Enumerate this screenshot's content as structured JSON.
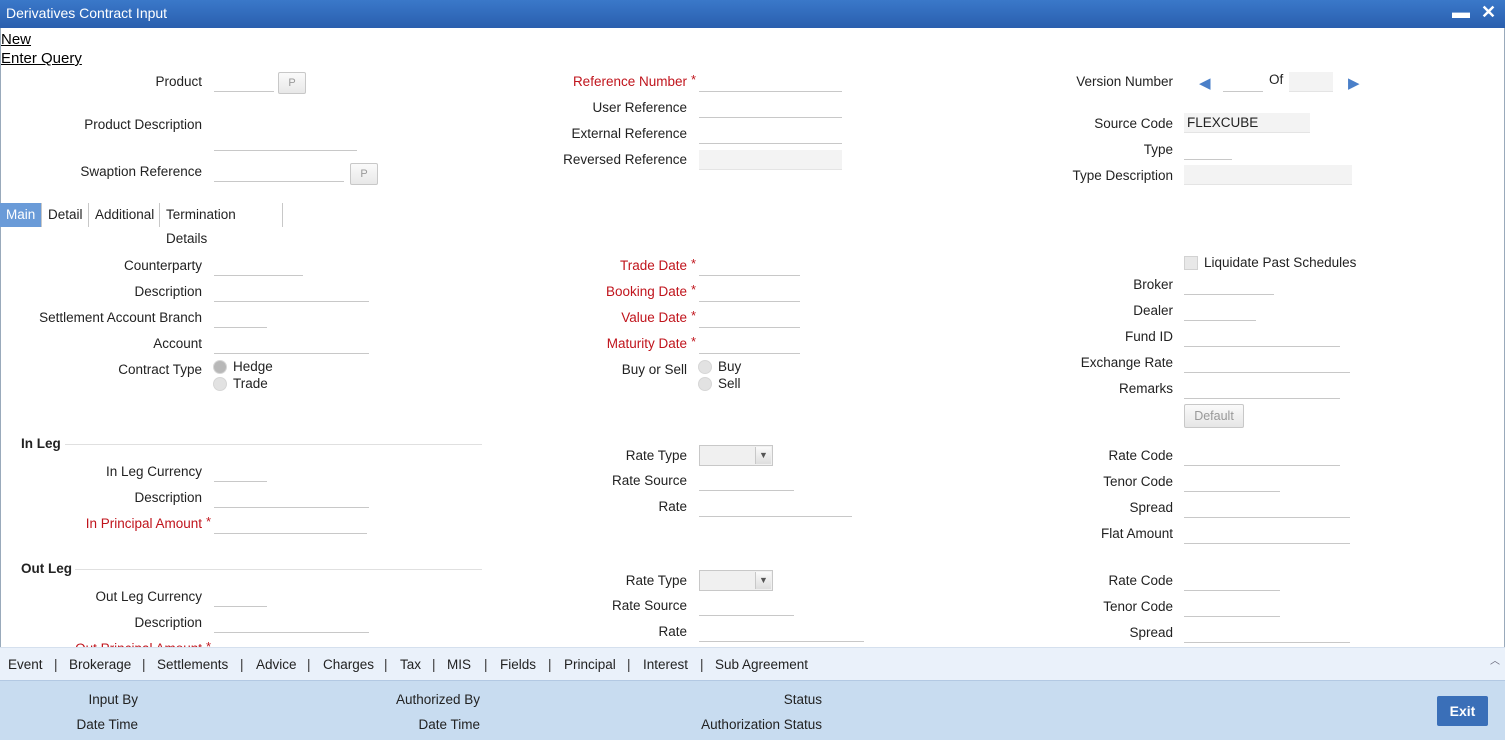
{
  "window": {
    "title": "Derivatives Contract Input",
    "minimize": "▬",
    "close": "✕"
  },
  "actions": {
    "new": "New",
    "enter_query": "Enter Query"
  },
  "header": {
    "product": "Product",
    "product_btn": "P",
    "product_description": "Product Description",
    "swaption_reference": "Swaption Reference",
    "swaption_btn": "P",
    "reference_number": "Reference Number",
    "user_reference": "User Reference",
    "external_reference": "External Reference",
    "reversed_reference": "Reversed Reference",
    "version_number": "Version Number",
    "of": "Of",
    "source_code": "Source Code",
    "source_code_value": "FLEXCUBE",
    "type": "Type",
    "type_description": "Type Description",
    "required_mark": "*"
  },
  "tabs": [
    "Main",
    "Detail",
    "Additional",
    "Termination Details"
  ],
  "main": {
    "counterparty": "Counterparty",
    "description": "Description",
    "settlement_account_branch": "Settlement Account Branch",
    "account": "Account",
    "contract_type": "Contract Type",
    "hedge": "Hedge",
    "trade": "Trade",
    "trade_date": "Trade Date",
    "booking_date": "Booking Date",
    "value_date": "Value Date",
    "maturity_date": "Maturity Date",
    "buy_or_sell": "Buy or Sell",
    "buy": "Buy",
    "sell": "Sell",
    "liquidate_past_schedules": "Liquidate Past Schedules",
    "broker": "Broker",
    "dealer": "Dealer",
    "fund_id": "Fund ID",
    "exchange_rate": "Exchange Rate",
    "remarks": "Remarks",
    "default_btn": "Default"
  },
  "in_leg": {
    "title": "In Leg",
    "currency": "In Leg Currency",
    "description": "Description",
    "principal": "In Principal Amount",
    "rate_type": "Rate Type",
    "rate_source": "Rate Source",
    "rate": "Rate",
    "rate_code": "Rate Code",
    "tenor_code": "Tenor Code",
    "spread": "Spread",
    "flat_amount": "Flat Amount"
  },
  "out_leg": {
    "title": "Out Leg",
    "currency": "Out Leg Currency",
    "description": "Description",
    "principal": "Out Principal Amount",
    "rate_type": "Rate Type",
    "rate_source": "Rate Source",
    "rate": "Rate",
    "rate_code": "Rate Code",
    "tenor_code": "Tenor Code",
    "spread": "Spread"
  },
  "subsystems": [
    "Event",
    "Brokerage",
    "Settlements",
    "Advice",
    "Charges",
    "Tax",
    "MIS",
    "Fields",
    "Principal",
    "Interest",
    "Sub Agreement"
  ],
  "footer": {
    "input_by": "Input By",
    "date_time": "Date Time",
    "authorized_by": "Authorized By",
    "date_time2": "Date Time",
    "status": "Status",
    "authorization_status": "Authorization Status",
    "exit": "Exit"
  }
}
